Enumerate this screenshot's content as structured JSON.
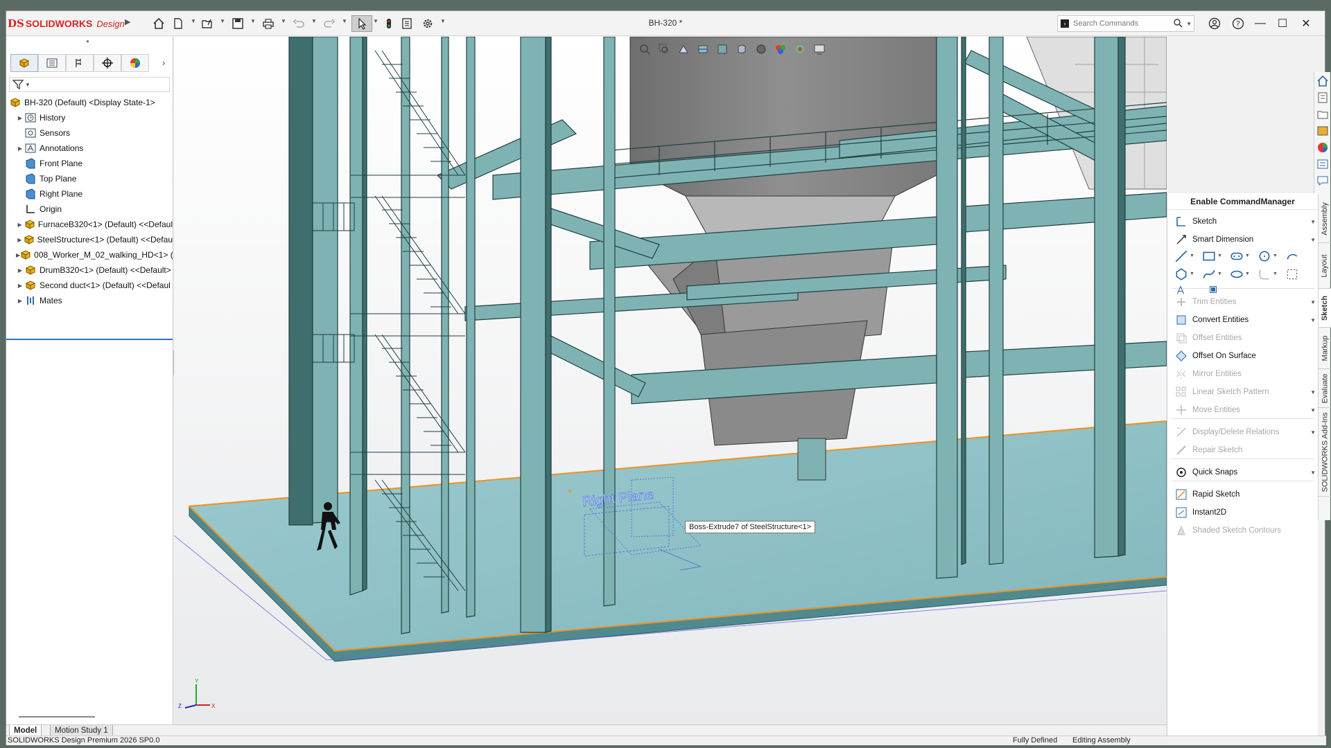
{
  "app": {
    "brand_mark": "DS",
    "brand_solid": "SOLIDWORKS",
    "brand_design": "Design",
    "document_title": "BH-320 *"
  },
  "toolbar": {
    "icons": [
      "home-icon",
      "new-document-icon",
      "open-icon",
      "save-icon",
      "print-icon",
      "undo-icon",
      "redo-icon",
      "select-icon",
      "rebuild-icon",
      "file-properties-icon",
      "options-icon"
    ]
  },
  "search": {
    "placeholder": "Search Commands"
  },
  "feature_tree": {
    "root": "BH-320 (Default) <Display State-1>",
    "items": [
      {
        "label": "History",
        "icon": "history-icon",
        "expandable": true
      },
      {
        "label": "Sensors",
        "icon": "sensors-icon",
        "expandable": false
      },
      {
        "label": "Annotations",
        "icon": "annotations-icon",
        "expandable": true
      },
      {
        "label": "Front Plane",
        "icon": "plane-icon",
        "expandable": false
      },
      {
        "label": "Top Plane",
        "icon": "plane-icon",
        "expandable": false
      },
      {
        "label": "Right Plane",
        "icon": "plane-icon",
        "expandable": false
      },
      {
        "label": "Origin",
        "icon": "origin-icon",
        "expandable": false
      },
      {
        "label": "FurnaceB320<1> (Default) <<Defaul",
        "icon": "part-icon",
        "expandable": true
      },
      {
        "label": "SteelStructure<1> (Default) <<Defau",
        "icon": "part-icon",
        "expandable": true
      },
      {
        "label": "008_Worker_M_02_walking_HD<1> (",
        "icon": "part-icon",
        "expandable": true
      },
      {
        "label": "DrumB320<1> (Default) <<Default>",
        "icon": "part-icon",
        "expandable": true
      },
      {
        "label": "Second duct<1> (Default) <<Defaul",
        "icon": "part-icon",
        "expandable": true
      },
      {
        "label": "Mates",
        "icon": "mates-icon",
        "expandable": true
      }
    ]
  },
  "viewport": {
    "tooltip": "Boss-Extrude7 of SteelStructure<1>",
    "plane_label": "Right Plane",
    "triad": {
      "x": "X",
      "y": "Y",
      "z": "Z"
    }
  },
  "command_manager": {
    "title": "Enable CommandManager",
    "items": [
      {
        "label": "Sketch",
        "enabled": true,
        "dropdown": true
      },
      {
        "label": "Smart Dimension",
        "enabled": true,
        "dropdown": true
      },
      {
        "label": "Trim Entities",
        "enabled": false,
        "dropdown": true
      },
      {
        "label": "Convert Entities",
        "enabled": true,
        "dropdown": true
      },
      {
        "label": "Offset Entities",
        "enabled": false,
        "dropdown": false
      },
      {
        "label": "Offset On Surface",
        "enabled": true,
        "dropdown": false
      },
      {
        "label": "Mirror Entities",
        "enabled": false,
        "dropdown": false
      },
      {
        "label": "Linear Sketch Pattern",
        "enabled": false,
        "dropdown": true
      },
      {
        "label": "Move Entities",
        "enabled": false,
        "dropdown": true
      },
      {
        "label": "Display/Delete Relations",
        "enabled": false,
        "dropdown": true
      },
      {
        "label": "Repair Sketch",
        "enabled": false,
        "dropdown": false
      },
      {
        "label": "Quick Snaps",
        "enabled": true,
        "dropdown": true
      },
      {
        "label": "Rapid Sketch",
        "enabled": true,
        "dropdown": false
      },
      {
        "label": "Instant2D",
        "enabled": true,
        "dropdown": false
      },
      {
        "label": "Shaded Sketch Contours",
        "enabled": false,
        "dropdown": false
      }
    ]
  },
  "side_tabs": [
    "Assembly",
    "Layout",
    "Sketch",
    "Markup",
    "Evaluate",
    "SOLIDWORKS Add-Ins"
  ],
  "side_tab_selected": "Sketch",
  "bottom_tabs": [
    {
      "label": "Model",
      "selected": true
    },
    {
      "label": "Motion Study 1",
      "selected": false
    }
  ],
  "status": {
    "product": "SOLIDWORKS Design Premium 2026 SP0.0",
    "definition": "Fully Defined",
    "mode": "Editing Assembly"
  },
  "colors": {
    "steel": "#7fb3b3",
    "steel_dark": "#3f6e6e",
    "floor": "#8fc3c8",
    "duct": "#8a8a8a",
    "selection": "#f0901e",
    "accent": "#2c73c9",
    "brand": "#d22222"
  }
}
